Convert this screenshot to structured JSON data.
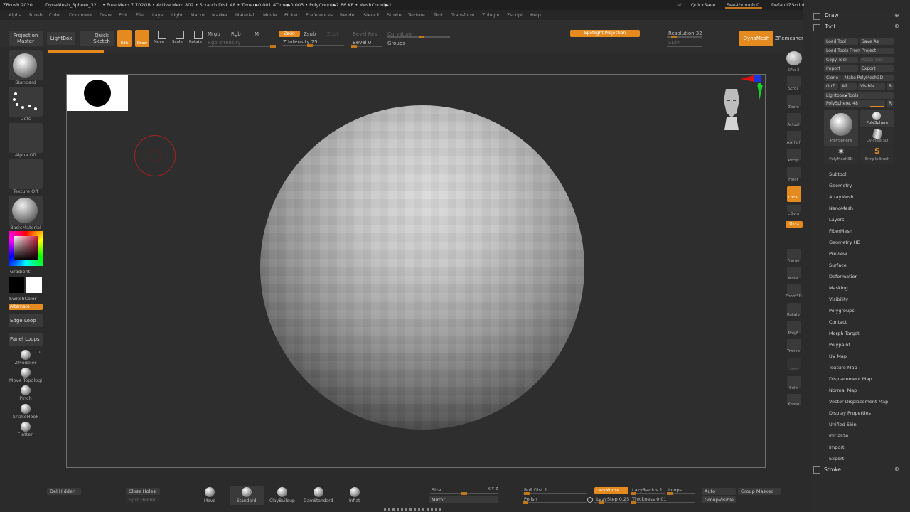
{
  "title_bar": {
    "app": "ZBrush 2020",
    "document": "DynaMesh_Sphere_32",
    "stats": "..• Free Mem 7.702GB • Active Mem 802 • Scratch Disk 48 • Timer▶0.001 ATime▶0.005 • PolyCount▶2.86 KP • MeshCount▶1",
    "ac": "AC",
    "quicksave": "QuickSave",
    "see_through": "See-through  0",
    "script": "DefaultZScript"
  },
  "menu": [
    "Alpha",
    "Brush",
    "Color",
    "Document",
    "Draw",
    "Edit",
    "File",
    "Layer",
    "Light",
    "Macro",
    "Marker",
    "Material",
    "Movie",
    "Picker",
    "Preferences",
    "Render",
    "Stencil",
    "Stroke",
    "Texture",
    "Tool",
    "Transform",
    "Zplugin",
    "Zscript",
    "Help"
  ],
  "top_shelf": {
    "projection_master": "Projection Master",
    "lightbox": "LightBox",
    "quick_sketch": "Quick Sketch",
    "edit": "Edit",
    "draw": "Draw",
    "move": "Move",
    "scale": "Scale",
    "rotate": "Rotate",
    "mrgb": "Mrgb",
    "rgb": "Rgb",
    "m": "M",
    "rgb_intensity": "Rgb Intensity",
    "zadd": "Zadd",
    "zsub": "Zsub",
    "zcut": "Zcut",
    "z_intensity": "Z Intensity 25",
    "bevel_res": "Bevel Res",
    "bevel": "Bevel 0",
    "curvature": "Curvature",
    "groups": "Groups",
    "spotlight": "Spotlight Projection",
    "resolution": "Resolution 32",
    "sdiv": "SDiv",
    "dynamesh": "DynaMesh",
    "zremesher": "ZRemesher"
  },
  "left_shelf": {
    "standard": "Standard",
    "dots": "Dots",
    "alpha_off": "Alpha Off",
    "texture_off": "Texture Off",
    "basic_material": "BasicMaterial",
    "gradient": "Gradient",
    "switch_color": "SwitchColor",
    "alternate": "Alternate",
    "edge_loop": "Edge Loop",
    "panel_loops": "Panel Loops",
    "zmodeler": "ZModeler",
    "zmodeler_num": "1",
    "move_topologic": "Move Topologi",
    "pinch": "Pinch",
    "snakehook": "SnakeHook",
    "flatten": "Flatten"
  },
  "right_shelf": [
    "BPR",
    "SPix 3",
    "Scroll",
    "Zoom",
    "Actual",
    "AAHalf",
    "Persp",
    "Floor",
    "Local",
    "L.Sym",
    "Qxyz",
    "Frame",
    "Move",
    "Zoom3D",
    "Rotate",
    "PolyF",
    "Transp",
    "Ghost",
    "Solo",
    "Xpose"
  ],
  "tool_panel": {
    "draw": "Draw",
    "tool": "Tool",
    "load_tool": "Load Tool",
    "save_as": "Save As",
    "load_from_project": "Load Tools From Project",
    "copy_tool": "Copy Tool",
    "paste_tool": "Paste Tool",
    "import": "Import",
    "export": "Export",
    "clone": "Clone",
    "make_polymesh": "Make PolyMesh3D",
    "goz": "GoZ",
    "all": "All",
    "visible": "Visible",
    "r": "R",
    "lightbox_tools": "Lightbox▶Tools",
    "polysphere_slider": "PolySphere. 48",
    "thumbs": [
      "PolySphere",
      "PolySphere",
      "Cylinder3D",
      "PolyMesh3D",
      "SimpleBrush"
    ],
    "sections": [
      "Subtool",
      "Geometry",
      "ArrayMesh",
      "NanoMesh",
      "Layers",
      "FiberMesh",
      "Geometry HD",
      "Preview",
      "Surface",
      "Deformation",
      "Masking",
      "Visibility",
      "Polygroups",
      "Contact",
      "Morph Target",
      "Polypaint",
      "UV Map",
      "Texture Map",
      "Displacement Map",
      "Normal Map",
      "Vector Displacement Map",
      "Display Properties",
      "Unified Skin",
      "Initialize",
      "Import",
      "Export"
    ],
    "stroke": "Stroke"
  },
  "bottom_shelf": {
    "del_hidden": "Del Hidden",
    "close_holes": "Close Holes",
    "split_hidden": "Split Hidden",
    "brushes": [
      "Move",
      "Standard",
      "ClayBuildup",
      "DamStandard",
      "Inflat"
    ],
    "size": "Size",
    "xyz": "X Y Z",
    "mirror": "Mirror",
    "roll_dist": "Roll Dist 1",
    "polish": "Polish",
    "lazymouse": "LazyMouse",
    "lazyradius": "LazyRadius 1",
    "loops": "Loops",
    "lazystep": "LazyStep 0.25",
    "thickness": "Thickness 0.01",
    "auto_groups": "Auto Groups",
    "group_masked": "Group Masked",
    "group_visible": "GroupVisible"
  },
  "colors": {
    "accent": "#e58a1f",
    "bg": "#2b2b2b"
  }
}
